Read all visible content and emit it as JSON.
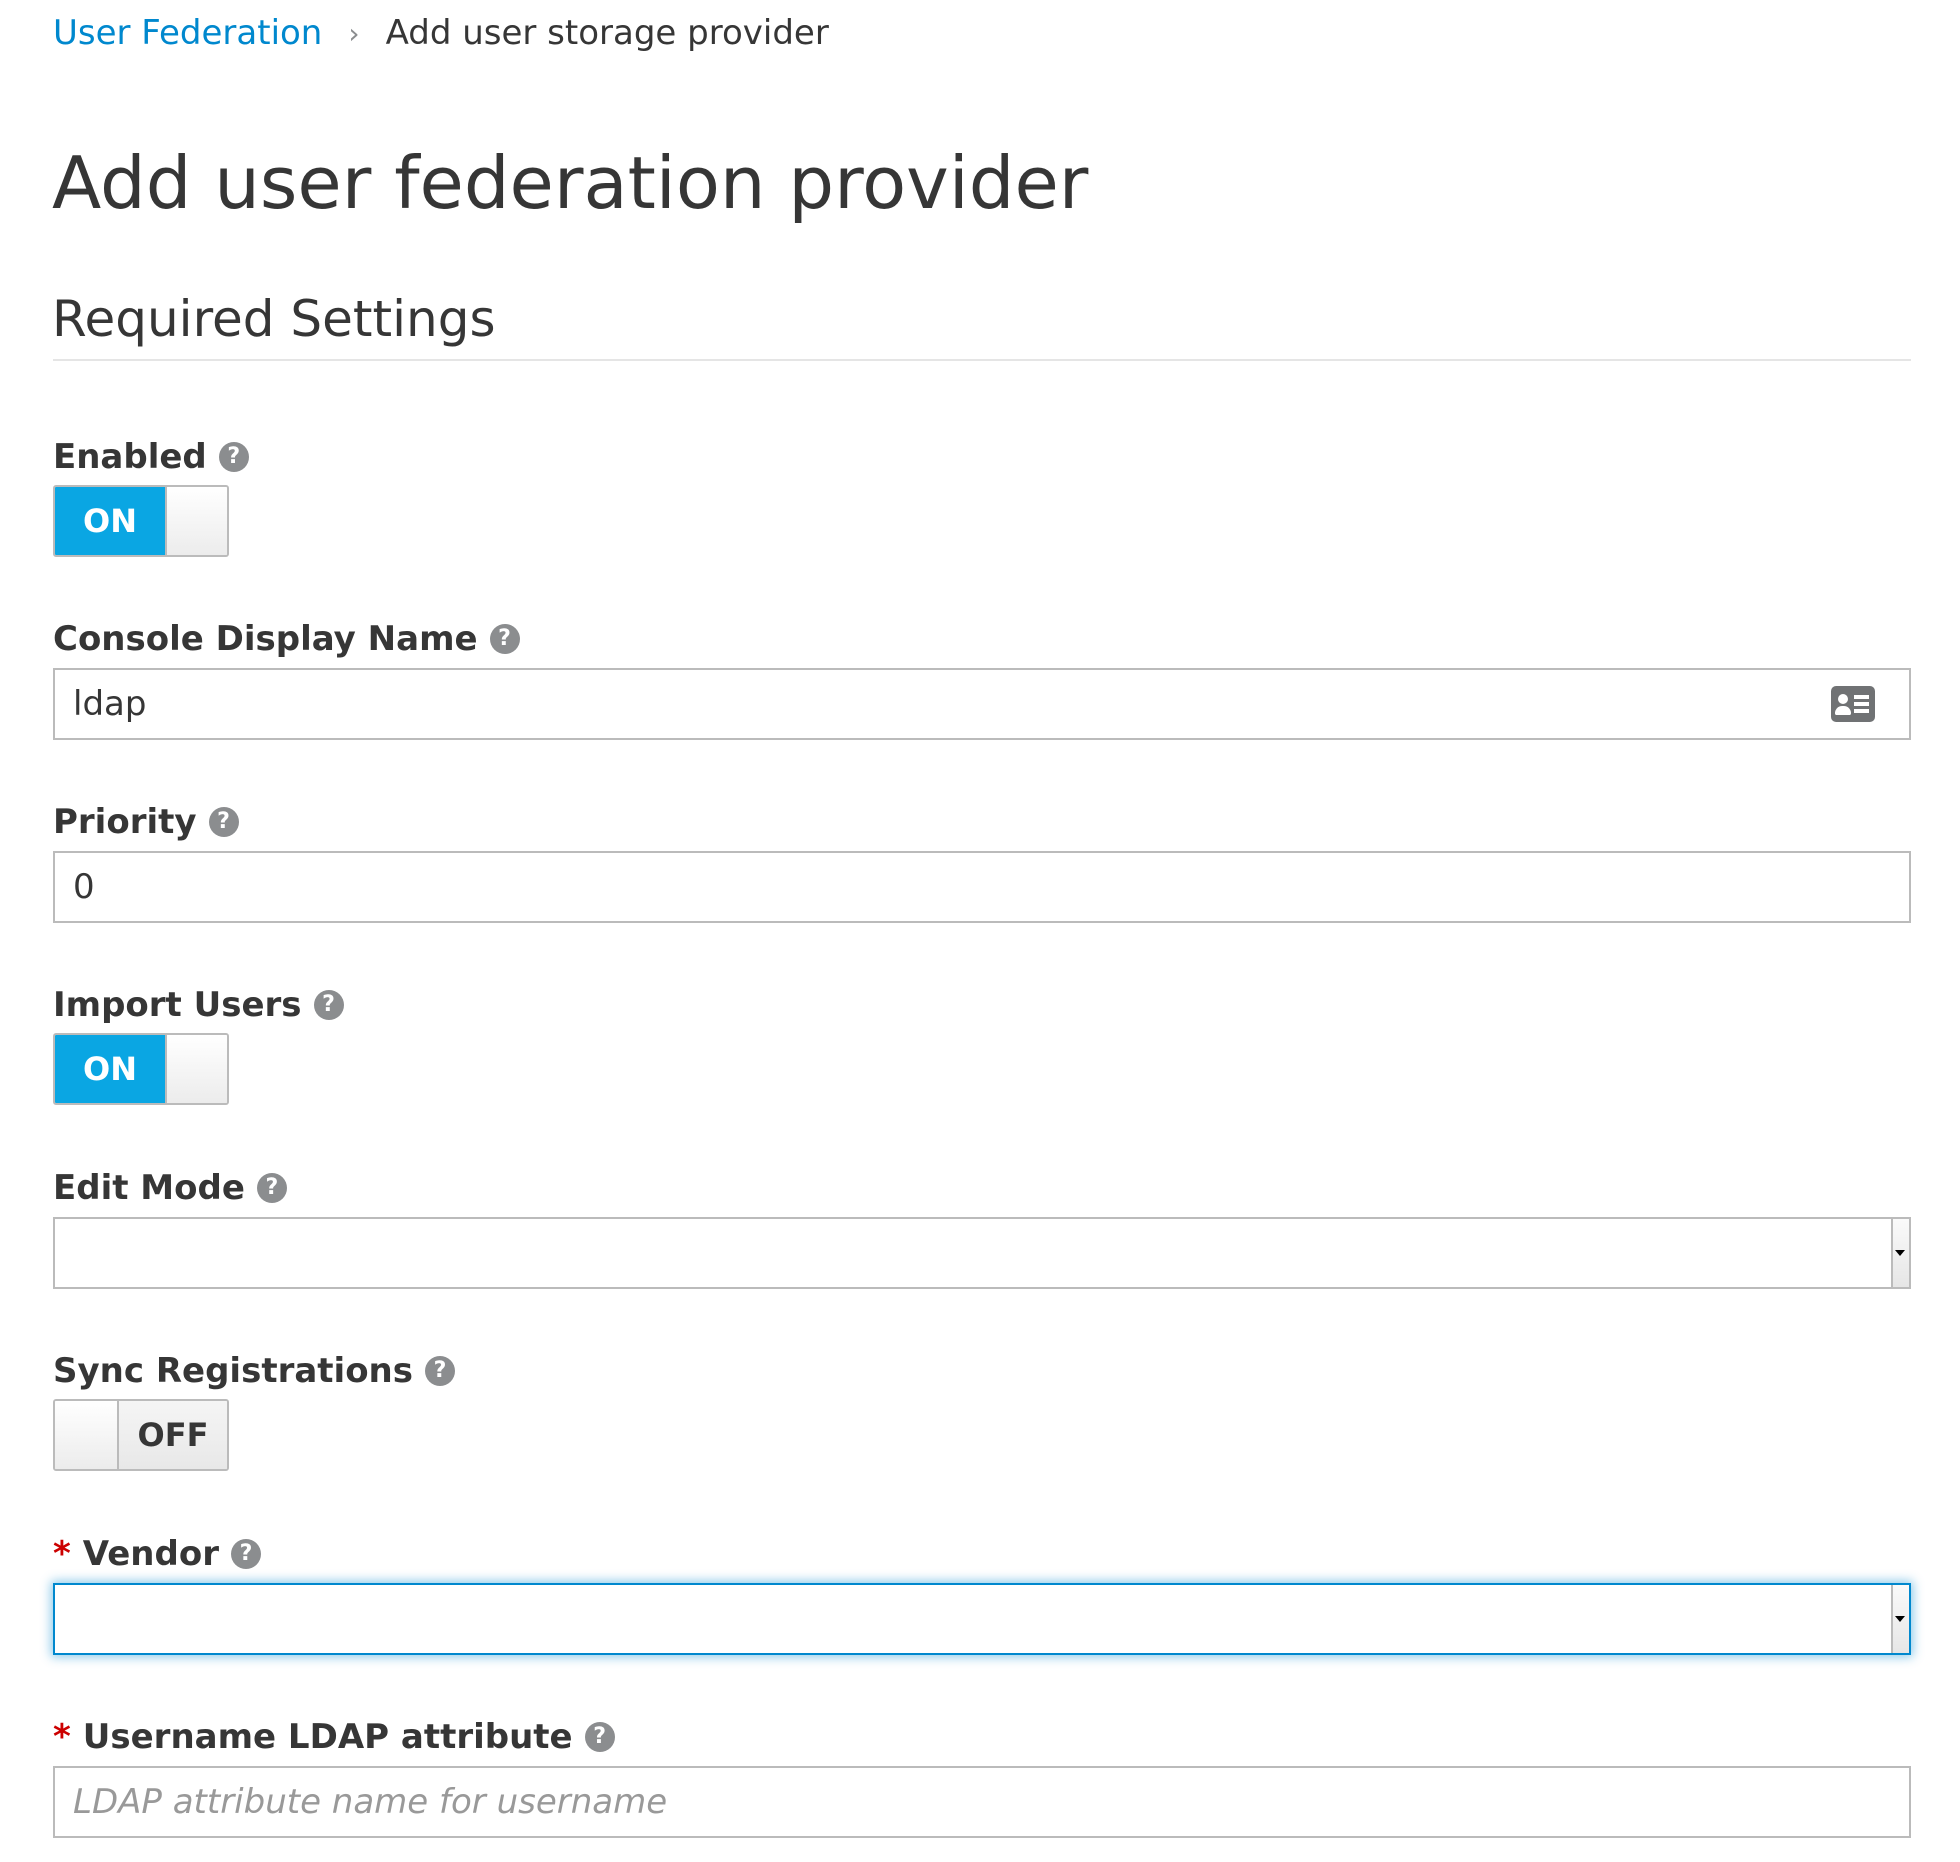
{
  "breadcrumb": {
    "parent": "User Federation",
    "separator": "›",
    "current": "Add user storage provider"
  },
  "page": {
    "title": "Add user federation provider"
  },
  "section": {
    "title": "Required Settings"
  },
  "help_icon_glyph": "?",
  "required_marker": "*",
  "fields": {
    "enabled": {
      "label": "Enabled",
      "state": "ON",
      "value": true
    },
    "console_display_name": {
      "label": "Console Display Name",
      "value": "ldap",
      "icon": "contact-card-icon"
    },
    "priority": {
      "label": "Priority",
      "value": "0"
    },
    "import_users": {
      "label": "Import Users",
      "state": "ON",
      "value": true
    },
    "edit_mode": {
      "label": "Edit Mode",
      "value": ""
    },
    "sync_registrations": {
      "label": "Sync Registrations",
      "state": "OFF",
      "value": false
    },
    "vendor": {
      "label": "Vendor",
      "required": true,
      "value": "",
      "focused": true
    },
    "username_ldap_attribute": {
      "label": "Username LDAP attribute",
      "required": true,
      "value": "",
      "placeholder": "LDAP attribute name for username"
    }
  },
  "colors": {
    "link": "#0088ce",
    "toggle_on": "#0aa6e3",
    "focus_border": "#0088ce",
    "required": "#cc0000",
    "text": "#363636"
  }
}
